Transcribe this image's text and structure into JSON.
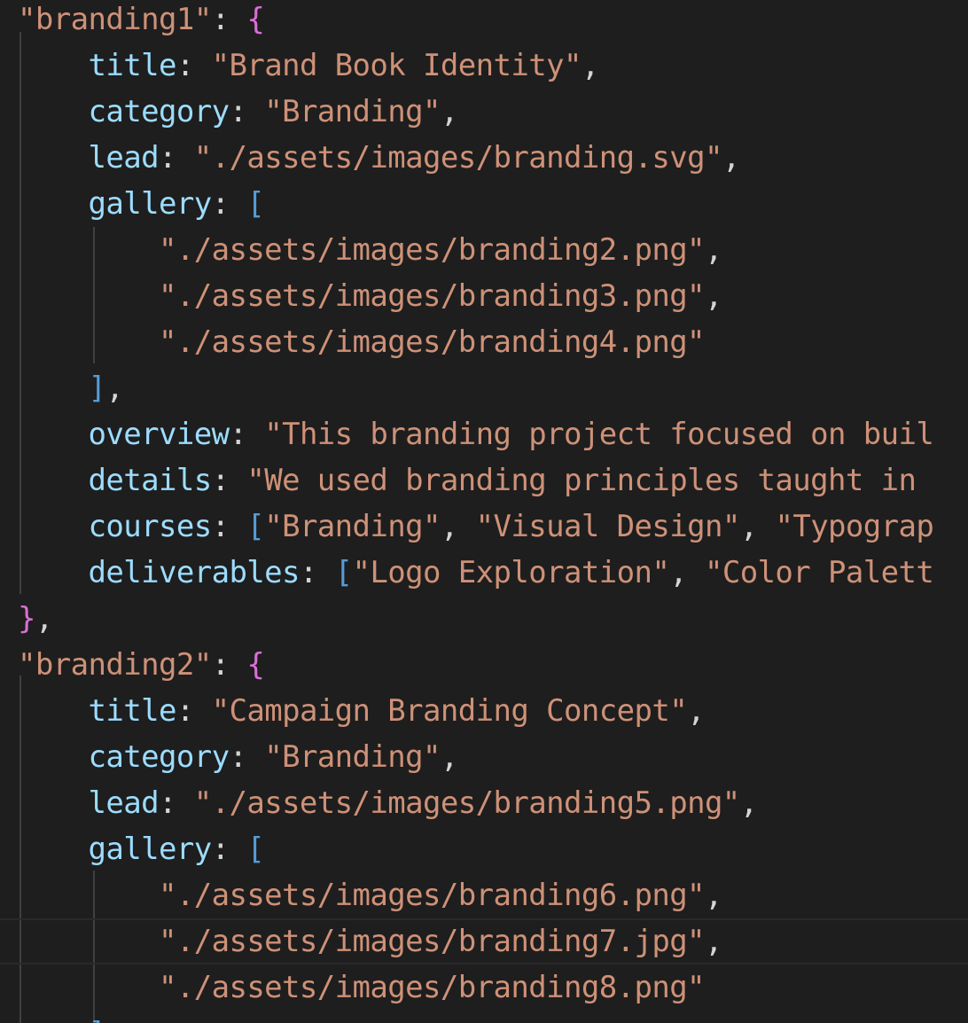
{
  "editor": {
    "lines": [
      [
        {
          "t": "\"branding1\"",
          "c": "str"
        },
        {
          "t": ": ",
          "c": "punc"
        },
        {
          "t": "{",
          "c": "brace"
        }
      ],
      [
        {
          "t": "    ",
          "c": "punc"
        },
        {
          "t": "title",
          "c": "key"
        },
        {
          "t": ": ",
          "c": "punc"
        },
        {
          "t": "\"Brand Book Identity\"",
          "c": "str"
        },
        {
          "t": ",",
          "c": "punc"
        }
      ],
      [
        {
          "t": "    ",
          "c": "punc"
        },
        {
          "t": "category",
          "c": "key"
        },
        {
          "t": ": ",
          "c": "punc"
        },
        {
          "t": "\"Branding\"",
          "c": "str"
        },
        {
          "t": ",",
          "c": "punc"
        }
      ],
      [
        {
          "t": "    ",
          "c": "punc"
        },
        {
          "t": "lead",
          "c": "key"
        },
        {
          "t": ": ",
          "c": "punc"
        },
        {
          "t": "\"./assets/images/branding.svg\"",
          "c": "str"
        },
        {
          "t": ",",
          "c": "punc"
        }
      ],
      [
        {
          "t": "    ",
          "c": "punc"
        },
        {
          "t": "gallery",
          "c": "key"
        },
        {
          "t": ": ",
          "c": "punc"
        },
        {
          "t": "[",
          "c": "bracket"
        }
      ],
      [
        {
          "t": "        ",
          "c": "punc"
        },
        {
          "t": "\"./assets/images/branding2.png\"",
          "c": "str"
        },
        {
          "t": ",",
          "c": "punc"
        }
      ],
      [
        {
          "t": "        ",
          "c": "punc"
        },
        {
          "t": "\"./assets/images/branding3.png\"",
          "c": "str"
        },
        {
          "t": ",",
          "c": "punc"
        }
      ],
      [
        {
          "t": "        ",
          "c": "punc"
        },
        {
          "t": "\"./assets/images/branding4.png\"",
          "c": "str"
        }
      ],
      [
        {
          "t": "    ",
          "c": "punc"
        },
        {
          "t": "]",
          "c": "bracket"
        },
        {
          "t": ",",
          "c": "punc"
        }
      ],
      [
        {
          "t": "    ",
          "c": "punc"
        },
        {
          "t": "overview",
          "c": "key"
        },
        {
          "t": ": ",
          "c": "punc"
        },
        {
          "t": "\"This branding project focused on buil",
          "c": "str"
        }
      ],
      [
        {
          "t": "    ",
          "c": "punc"
        },
        {
          "t": "details",
          "c": "key"
        },
        {
          "t": ": ",
          "c": "punc"
        },
        {
          "t": "\"We used branding principles taught in ",
          "c": "str"
        }
      ],
      [
        {
          "t": "    ",
          "c": "punc"
        },
        {
          "t": "courses",
          "c": "key"
        },
        {
          "t": ": ",
          "c": "punc"
        },
        {
          "t": "[",
          "c": "bracket"
        },
        {
          "t": "\"Branding\"",
          "c": "str"
        },
        {
          "t": ", ",
          "c": "punc"
        },
        {
          "t": "\"Visual Design\"",
          "c": "str"
        },
        {
          "t": ", ",
          "c": "punc"
        },
        {
          "t": "\"Typograp",
          "c": "str"
        }
      ],
      [
        {
          "t": "    ",
          "c": "punc"
        },
        {
          "t": "deliverables",
          "c": "key"
        },
        {
          "t": ": ",
          "c": "punc"
        },
        {
          "t": "[",
          "c": "bracket"
        },
        {
          "t": "\"Logo Exploration\"",
          "c": "str"
        },
        {
          "t": ", ",
          "c": "punc"
        },
        {
          "t": "\"Color Palett",
          "c": "str"
        }
      ],
      [
        {
          "t": "}",
          "c": "brace"
        },
        {
          "t": ",",
          "c": "punc"
        }
      ],
      [
        {
          "t": "\"branding2\"",
          "c": "str"
        },
        {
          "t": ": ",
          "c": "punc"
        },
        {
          "t": "{",
          "c": "brace"
        }
      ],
      [
        {
          "t": "    ",
          "c": "punc"
        },
        {
          "t": "title",
          "c": "key"
        },
        {
          "t": ": ",
          "c": "punc"
        },
        {
          "t": "\"Campaign Branding Concept\"",
          "c": "str"
        },
        {
          "t": ",",
          "c": "punc"
        }
      ],
      [
        {
          "t": "    ",
          "c": "punc"
        },
        {
          "t": "category",
          "c": "key"
        },
        {
          "t": ": ",
          "c": "punc"
        },
        {
          "t": "\"Branding\"",
          "c": "str"
        },
        {
          "t": ",",
          "c": "punc"
        }
      ],
      [
        {
          "t": "    ",
          "c": "punc"
        },
        {
          "t": "lead",
          "c": "key"
        },
        {
          "t": ": ",
          "c": "punc"
        },
        {
          "t": "\"./assets/images/branding5.png\"",
          "c": "str"
        },
        {
          "t": ",",
          "c": "punc"
        }
      ],
      [
        {
          "t": "    ",
          "c": "punc"
        },
        {
          "t": "gallery",
          "c": "key"
        },
        {
          "t": ": ",
          "c": "punc"
        },
        {
          "t": "[",
          "c": "bracket"
        }
      ],
      [
        {
          "t": "        ",
          "c": "punc"
        },
        {
          "t": "\"./assets/images/branding6.png\"",
          "c": "str"
        },
        {
          "t": ",",
          "c": "punc"
        }
      ],
      [
        {
          "t": "        ",
          "c": "punc"
        },
        {
          "t": "\"./assets/images/branding7.jpg\"",
          "c": "str"
        },
        {
          "t": ",",
          "c": "punc"
        }
      ],
      [
        {
          "t": "        ",
          "c": "punc"
        },
        {
          "t": "\"./assets/images/branding8.png\"",
          "c": "str"
        }
      ],
      [
        {
          "t": "    ",
          "c": "punc"
        },
        {
          "t": "]",
          "c": "bracket"
        }
      ]
    ],
    "current_line": 20
  },
  "colors": {
    "background": "#1e1e1e",
    "string": "#ce9178",
    "key": "#9cdcfe",
    "punctuation": "#d4d4d4",
    "brace": "#da70d6",
    "bracket": "#569cd6",
    "indent_guide": "#404040"
  }
}
